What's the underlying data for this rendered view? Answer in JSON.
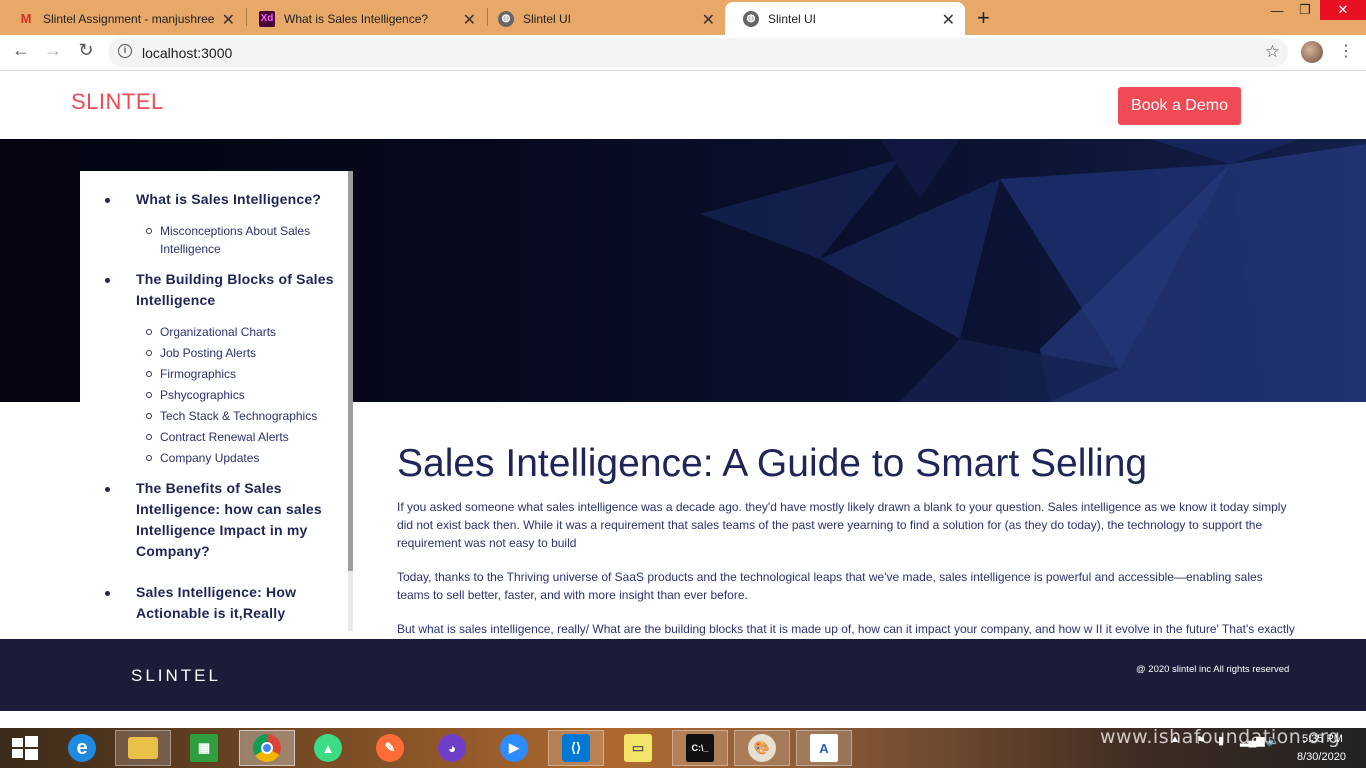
{
  "browser": {
    "tabs": [
      {
        "title": "Slintel Assignment - manjushree",
        "icon": "M",
        "icon_color": "#d93025"
      },
      {
        "title": "What is Sales Intelligence?",
        "icon": "Xd",
        "icon_color": "#470137"
      },
      {
        "title": "Slintel UI",
        "icon": "globe"
      },
      {
        "title": "Slintel UI",
        "icon": "globe"
      }
    ],
    "url": "localhost:3000",
    "new_tab": "+"
  },
  "site": {
    "logo": "SLINTEL",
    "cta": "Book a Demo",
    "accent": "#f04a55",
    "navy": "#1e2558"
  },
  "toc": {
    "sections": [
      {
        "title": "What is Sales Intelligence?",
        "items": [
          "Misconceptions About Sales Intelligence"
        ]
      },
      {
        "title": "The Building Blocks of Sales Intelligence",
        "items": [
          "Organizational Charts",
          "Job Posting Alerts",
          "Firmographics",
          "Pshycographics",
          "Tech Stack & Technographics",
          "Contract Renewal Alerts",
          "Company Updates"
        ]
      },
      {
        "title": "The Benefits of Sales Intelligence: how can sales Intelligence Impact in my Company?",
        "items": []
      },
      {
        "title": "Sales Intelligence: How Actionable is it,Really",
        "items": []
      }
    ]
  },
  "article": {
    "title": "Sales Intelligence: A Guide to Smart Selling",
    "paragraphs": [
      "If you asked someone what sales intelligence was a decade ago. they'd have mostly likely drawn a blank to your question. Sales intelligence as we know it today simply did not exist back then. While it was a requirement that sales teams of the past were yearning to find a solution for (as they do today), the technology to support the requirement was not easy to build",
      "Today, thanks to the Thriving universe of SaaS products and the technological leaps that we've made, sales intelligence is powerful and accessible—enabling sales teams to sell better, faster, and with more insight than ever before.",
      "But what is sales intelligence, really/ What are the building blocks that it is made up of, how can it impact your company, and how w II it evolve in the future' That's exactly"
    ]
  },
  "footer": {
    "logo": "SLINTEL",
    "copyright": "@ 2020 slintel inc All rights reserved"
  },
  "taskbar": {
    "watermark": "www.ishafoundation.org",
    "time": "5:35 PM",
    "date": "8/30/2020"
  }
}
